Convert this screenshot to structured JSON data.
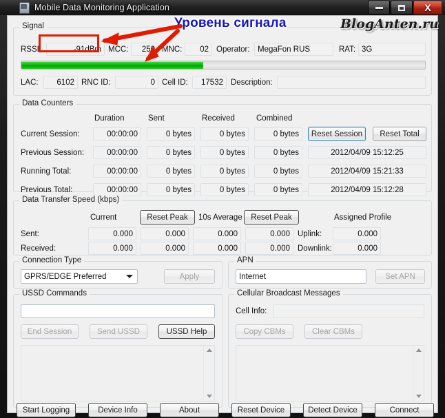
{
  "window": {
    "title": "Mobile Data Monitoring Application",
    "icon": "mobile-phone-icon",
    "minimize_label": "–",
    "maximize_label": "□",
    "close_label": "X"
  },
  "annotations": {
    "signal_level_text": "Уровень сигнала",
    "watermark": "BlogAnten.ru",
    "arrow_color": "#e01b00",
    "text_color": "#1414c8"
  },
  "signal": {
    "caption": "Signal",
    "rssi_label": "RSSI:",
    "rssi_value": "-91dBm",
    "mcc_label": "MCC:",
    "mcc_value": "250",
    "mnc_label": "MNC:",
    "mnc_value": "02",
    "operator_label": "Operator:",
    "operator_value": "MegaFon RUS",
    "rat_label": "RAT:",
    "rat_value": "3G",
    "bar_percent": 45,
    "bar_color": "#0fb80f",
    "lac_label": "LAC:",
    "lac_value": "6102",
    "rnc_label": "RNC ID:",
    "rnc_value": "0",
    "cellid_label": "Cell ID:",
    "cellid_value": "17532",
    "description_label": "Description:",
    "description_value": ""
  },
  "counters": {
    "caption": "Data Counters",
    "columns": [
      "Duration",
      "Sent",
      "Received",
      "Combined"
    ],
    "rows": [
      {
        "label": "Current Session:",
        "duration": "00:00:00",
        "sent": "0 bytes",
        "received": "0 bytes",
        "combined": "0 bytes",
        "timestamp": ""
      },
      {
        "label": "Previous Session:",
        "duration": "00:00:00",
        "sent": "0 bytes",
        "received": "0 bytes",
        "combined": "0 bytes",
        "timestamp": "2012/04/09 15:12:25"
      },
      {
        "label": "Running Total:",
        "duration": "00:00:00",
        "sent": "0 bytes",
        "received": "0 bytes",
        "combined": "0 bytes",
        "timestamp": "2012/04/09 15:21:33"
      },
      {
        "label": "Previous Total:",
        "duration": "00:00:00",
        "sent": "0 bytes",
        "received": "0 bytes",
        "combined": "0 bytes",
        "timestamp": "2012/04/09 15:12:28"
      }
    ],
    "reset_session_label": "Reset Session",
    "reset_total_label": "Reset Total"
  },
  "speed": {
    "caption": "Data Transfer Speed (kbps)",
    "current_label": "Current",
    "reset_peak_1_label": "Reset Peak",
    "average_label": "10s Average",
    "reset_peak_2_label": "Reset Peak",
    "assigned_profile_label": "Assigned Profile",
    "rows": [
      {
        "label": "Sent:",
        "current": "0.000",
        "current_peak": "0.000",
        "average": "0.000",
        "average_peak": "0.000",
        "profile_label": "Uplink:",
        "profile_value": "0.000"
      },
      {
        "label": "Received:",
        "current": "0.000",
        "current_peak": "0.000",
        "average": "0.000",
        "average_peak": "0.000",
        "profile_label": "Downlink:",
        "profile_value": "0.000"
      }
    ]
  },
  "connection_type": {
    "caption": "Connection Type",
    "selected": "GPRS/EDGE Preferred",
    "options": [
      "GPRS/EDGE Preferred"
    ],
    "apply_label": "Apply"
  },
  "apn": {
    "caption": "APN",
    "value": "Internet",
    "set_label": "Set APN"
  },
  "ussd": {
    "caption": "USSD Commands",
    "input_value": "",
    "end_session_label": "End Session",
    "send_label": "Send USSD",
    "help_label": "USSD Help",
    "log_value": ""
  },
  "cbm": {
    "caption": "Cellular Broadcast Messages",
    "cell_info_label": "Cell Info:",
    "cell_info_value": "",
    "copy_label": "Copy CBMs",
    "clear_label": "Clear CBMs",
    "log_value": ""
  },
  "bottom_bar": {
    "buttons": [
      "Start Logging",
      "Device Info",
      "About",
      "Reset Device",
      "Detect Device",
      "Connect"
    ]
  }
}
